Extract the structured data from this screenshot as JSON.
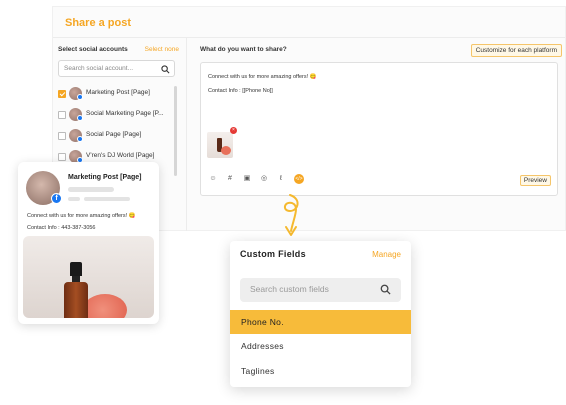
{
  "colors": {
    "accent": "#f5a623",
    "active_row": "#f7bb3a",
    "facebook": "#1877f2"
  },
  "share": {
    "title": "Share a post",
    "left": {
      "header": "Select social accounts",
      "select_none": "Select none",
      "search_placeholder": "Search social account...",
      "accounts": [
        {
          "name": "Marketing Post [Page]",
          "checked": true
        },
        {
          "name": "Social Marketing Page [P...",
          "checked": false
        },
        {
          "name": "Social Page [Page]",
          "checked": false
        },
        {
          "name": "V'ren's DJ World [Page]",
          "checked": false
        }
      ]
    },
    "right": {
      "header": "What do you want to share?",
      "customize": "Customize for each platform",
      "post_line1": "Connect with us for more amazing offers! 😋",
      "post_line2": "Contact Info : [[Phone No]]",
      "remove_icon": "×",
      "toolbar_icons": [
        "emoji-icon",
        "hashtag-icon",
        "image-icon",
        "ai-icon",
        "link-icon",
        "custom-fields-icon"
      ],
      "toolbar_glyphs": [
        "☺",
        "#",
        "▣",
        "◎",
        "ℓ",
        "</>"
      ],
      "preview": "Preview"
    }
  },
  "preview_card": {
    "name": "Marketing Post [Page]",
    "fb_glyph": "f",
    "line1": "Connect with us for more amazing offers! 😋",
    "line2": "Contact Info : 443-387-3056"
  },
  "custom_fields": {
    "title": "Custom Fields",
    "manage": "Manage",
    "search_placeholder": "Search custom fields",
    "items": [
      {
        "label": "Phone No.",
        "active": true
      },
      {
        "label": "Addresses",
        "active": false
      },
      {
        "label": "Taglines",
        "active": false
      }
    ]
  }
}
